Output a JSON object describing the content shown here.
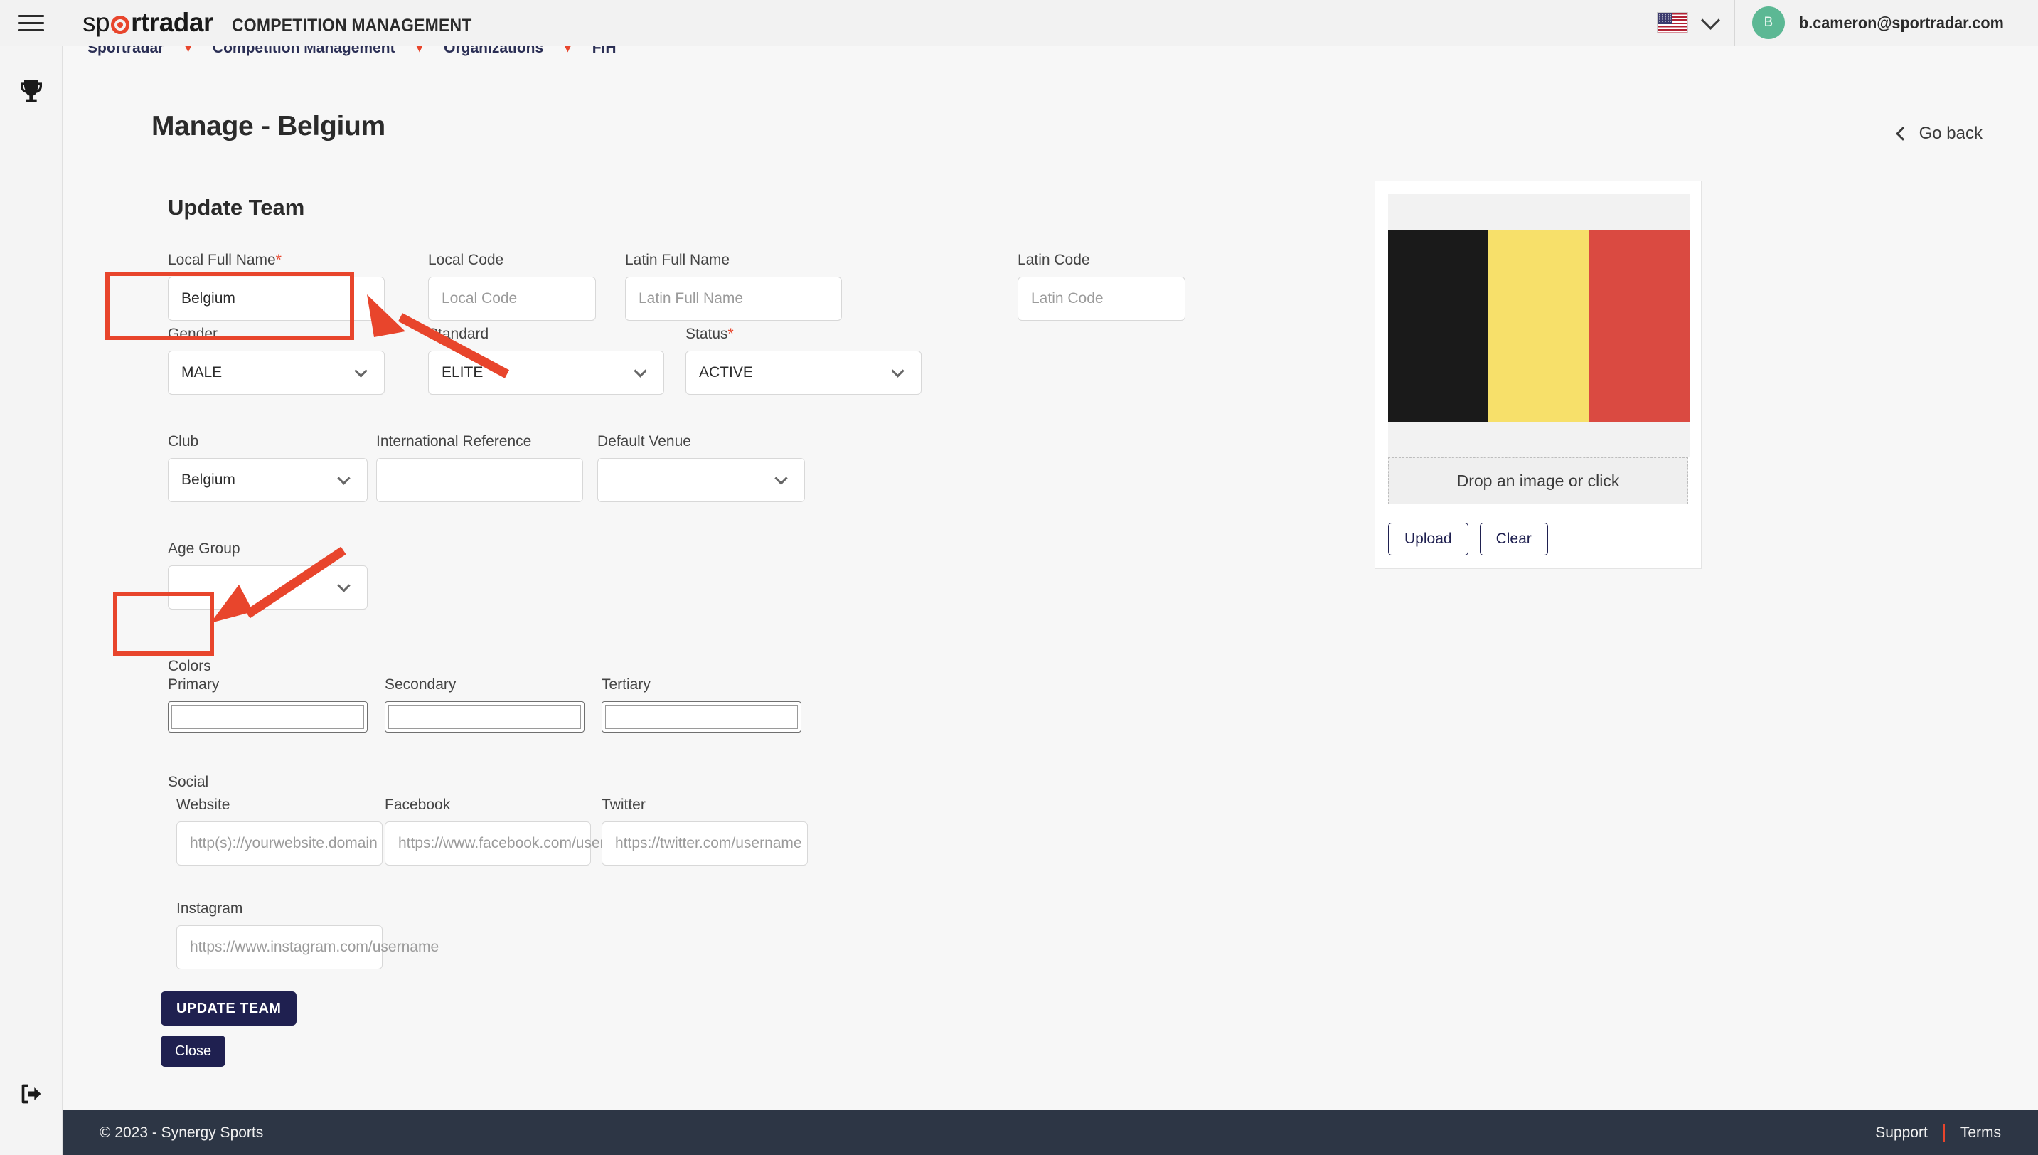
{
  "topbar": {
    "menu_icon": "hamburger-icon",
    "brand": {
      "part1": "sp",
      "part2": "rtradar",
      "subtitle": "COMPETITION MANAGEMENT"
    },
    "language": {
      "flag": "us-flag-icon",
      "chevron": "chevron-down-icon"
    },
    "user": {
      "initial": "B",
      "email": "b.cameron@sportradar.com"
    }
  },
  "rail": {
    "items": [
      {
        "icon": "trophy-icon",
        "name": "competitions"
      },
      {
        "icon": "logout-icon",
        "name": "logout"
      }
    ]
  },
  "breadcrumb": {
    "items": [
      "Sportradar",
      "Competition Management",
      "Organizations",
      "FIH"
    ],
    "separator": "▾"
  },
  "header": {
    "title": "Manage - Belgium",
    "go_back_label": "Go back",
    "go_back_icon": "chevron-left-icon"
  },
  "card": {
    "title": "Update Team"
  },
  "form": {
    "local_full_name": {
      "label": "Local Full Name",
      "required": true,
      "value": "Belgium",
      "placeholder": "Local Full Name"
    },
    "local_code": {
      "label": "Local Code",
      "required": false,
      "value": "",
      "placeholder": "Local Code"
    },
    "latin_full_name": {
      "label": "Latin Full Name",
      "required": false,
      "value": "",
      "placeholder": "Latin Full Name"
    },
    "latin_code": {
      "label": "Latin Code",
      "required": false,
      "value": "",
      "placeholder": "Latin Code"
    },
    "gender": {
      "label": "Gender",
      "required": false,
      "value": "MALE"
    },
    "standard": {
      "label": "Standard",
      "required": false,
      "value": "ELITE"
    },
    "status": {
      "label": "Status",
      "required": true,
      "value": "ACTIVE"
    },
    "club": {
      "label": "Club",
      "required": false,
      "value": "Belgium"
    },
    "international_reference": {
      "label": "International Reference",
      "required": false,
      "value": "",
      "placeholder": ""
    },
    "default_venue": {
      "label": "Default Venue",
      "required": false,
      "value": ""
    },
    "age_group": {
      "label": "Age Group",
      "required": false,
      "value": ""
    },
    "colors_section_label": "Colors",
    "color_primary": {
      "label": "Primary",
      "value": "#ffffff"
    },
    "color_secondary": {
      "label": "Secondary",
      "value": "#ffffff"
    },
    "color_tertiary": {
      "label": "Tertiary",
      "value": "#ffffff"
    },
    "social_section_label": "Social",
    "website": {
      "label": "Website",
      "value": "",
      "placeholder": "http(s)://yourwebsite.domain"
    },
    "facebook": {
      "label": "Facebook",
      "value": "",
      "placeholder": "https://www.facebook.com/username"
    },
    "twitter": {
      "label": "Twitter",
      "value": "",
      "placeholder": "https://twitter.com/username"
    },
    "instagram": {
      "label": "Instagram",
      "value": "",
      "placeholder": "https://www.instagram.com/username"
    },
    "submit_label": "UPDATE TEAM",
    "close_label": "Close"
  },
  "media": {
    "flag_colors": [
      "#1a1a1a",
      "#f7e06a",
      "#da4a41"
    ],
    "dropzone_label": "Drop an image or click",
    "upload_label": "Upload",
    "clear_label": "Clear"
  },
  "footer": {
    "copyright": "© 2023 - Synergy Sports",
    "support_label": "Support",
    "terms_label": "Terms"
  },
  "annotations": {
    "highlight_color": "#e8452c",
    "boxes": [
      "club-field-highlight",
      "action-buttons-highlight"
    ],
    "arrows": [
      "arrow-to-club-field",
      "arrow-to-action-buttons"
    ]
  }
}
